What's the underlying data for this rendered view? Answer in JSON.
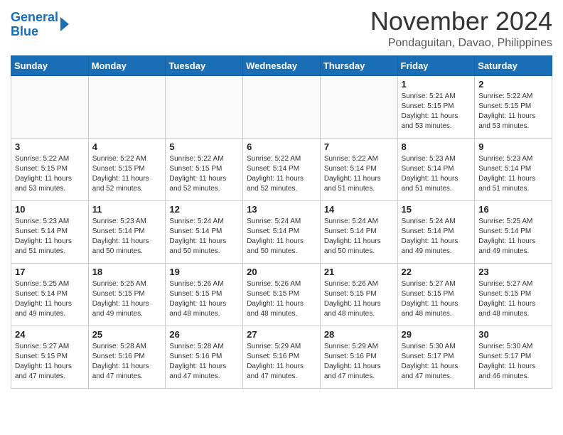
{
  "header": {
    "logo_line1": "General",
    "logo_line2": "Blue",
    "month": "November 2024",
    "location": "Pondaguitan, Davao, Philippines"
  },
  "weekdays": [
    "Sunday",
    "Monday",
    "Tuesday",
    "Wednesday",
    "Thursday",
    "Friday",
    "Saturday"
  ],
  "weeks": [
    [
      {
        "day": "",
        "info": ""
      },
      {
        "day": "",
        "info": ""
      },
      {
        "day": "",
        "info": ""
      },
      {
        "day": "",
        "info": ""
      },
      {
        "day": "",
        "info": ""
      },
      {
        "day": "1",
        "info": "Sunrise: 5:21 AM\nSunset: 5:15 PM\nDaylight: 11 hours\nand 53 minutes."
      },
      {
        "day": "2",
        "info": "Sunrise: 5:22 AM\nSunset: 5:15 PM\nDaylight: 11 hours\nand 53 minutes."
      }
    ],
    [
      {
        "day": "3",
        "info": "Sunrise: 5:22 AM\nSunset: 5:15 PM\nDaylight: 11 hours\nand 53 minutes."
      },
      {
        "day": "4",
        "info": "Sunrise: 5:22 AM\nSunset: 5:15 PM\nDaylight: 11 hours\nand 52 minutes."
      },
      {
        "day": "5",
        "info": "Sunrise: 5:22 AM\nSunset: 5:15 PM\nDaylight: 11 hours\nand 52 minutes."
      },
      {
        "day": "6",
        "info": "Sunrise: 5:22 AM\nSunset: 5:14 PM\nDaylight: 11 hours\nand 52 minutes."
      },
      {
        "day": "7",
        "info": "Sunrise: 5:22 AM\nSunset: 5:14 PM\nDaylight: 11 hours\nand 51 minutes."
      },
      {
        "day": "8",
        "info": "Sunrise: 5:23 AM\nSunset: 5:14 PM\nDaylight: 11 hours\nand 51 minutes."
      },
      {
        "day": "9",
        "info": "Sunrise: 5:23 AM\nSunset: 5:14 PM\nDaylight: 11 hours\nand 51 minutes."
      }
    ],
    [
      {
        "day": "10",
        "info": "Sunrise: 5:23 AM\nSunset: 5:14 PM\nDaylight: 11 hours\nand 51 minutes."
      },
      {
        "day": "11",
        "info": "Sunrise: 5:23 AM\nSunset: 5:14 PM\nDaylight: 11 hours\nand 50 minutes."
      },
      {
        "day": "12",
        "info": "Sunrise: 5:24 AM\nSunset: 5:14 PM\nDaylight: 11 hours\nand 50 minutes."
      },
      {
        "day": "13",
        "info": "Sunrise: 5:24 AM\nSunset: 5:14 PM\nDaylight: 11 hours\nand 50 minutes."
      },
      {
        "day": "14",
        "info": "Sunrise: 5:24 AM\nSunset: 5:14 PM\nDaylight: 11 hours\nand 50 minutes."
      },
      {
        "day": "15",
        "info": "Sunrise: 5:24 AM\nSunset: 5:14 PM\nDaylight: 11 hours\nand 49 minutes."
      },
      {
        "day": "16",
        "info": "Sunrise: 5:25 AM\nSunset: 5:14 PM\nDaylight: 11 hours\nand 49 minutes."
      }
    ],
    [
      {
        "day": "17",
        "info": "Sunrise: 5:25 AM\nSunset: 5:14 PM\nDaylight: 11 hours\nand 49 minutes."
      },
      {
        "day": "18",
        "info": "Sunrise: 5:25 AM\nSunset: 5:15 PM\nDaylight: 11 hours\nand 49 minutes."
      },
      {
        "day": "19",
        "info": "Sunrise: 5:26 AM\nSunset: 5:15 PM\nDaylight: 11 hours\nand 48 minutes."
      },
      {
        "day": "20",
        "info": "Sunrise: 5:26 AM\nSunset: 5:15 PM\nDaylight: 11 hours\nand 48 minutes."
      },
      {
        "day": "21",
        "info": "Sunrise: 5:26 AM\nSunset: 5:15 PM\nDaylight: 11 hours\nand 48 minutes."
      },
      {
        "day": "22",
        "info": "Sunrise: 5:27 AM\nSunset: 5:15 PM\nDaylight: 11 hours\nand 48 minutes."
      },
      {
        "day": "23",
        "info": "Sunrise: 5:27 AM\nSunset: 5:15 PM\nDaylight: 11 hours\nand 48 minutes."
      }
    ],
    [
      {
        "day": "24",
        "info": "Sunrise: 5:27 AM\nSunset: 5:15 PM\nDaylight: 11 hours\nand 47 minutes."
      },
      {
        "day": "25",
        "info": "Sunrise: 5:28 AM\nSunset: 5:16 PM\nDaylight: 11 hours\nand 47 minutes."
      },
      {
        "day": "26",
        "info": "Sunrise: 5:28 AM\nSunset: 5:16 PM\nDaylight: 11 hours\nand 47 minutes."
      },
      {
        "day": "27",
        "info": "Sunrise: 5:29 AM\nSunset: 5:16 PM\nDaylight: 11 hours\nand 47 minutes."
      },
      {
        "day": "28",
        "info": "Sunrise: 5:29 AM\nSunset: 5:16 PM\nDaylight: 11 hours\nand 47 minutes."
      },
      {
        "day": "29",
        "info": "Sunrise: 5:30 AM\nSunset: 5:17 PM\nDaylight: 11 hours\nand 47 minutes."
      },
      {
        "day": "30",
        "info": "Sunrise: 5:30 AM\nSunset: 5:17 PM\nDaylight: 11 hours\nand 46 minutes."
      }
    ]
  ]
}
